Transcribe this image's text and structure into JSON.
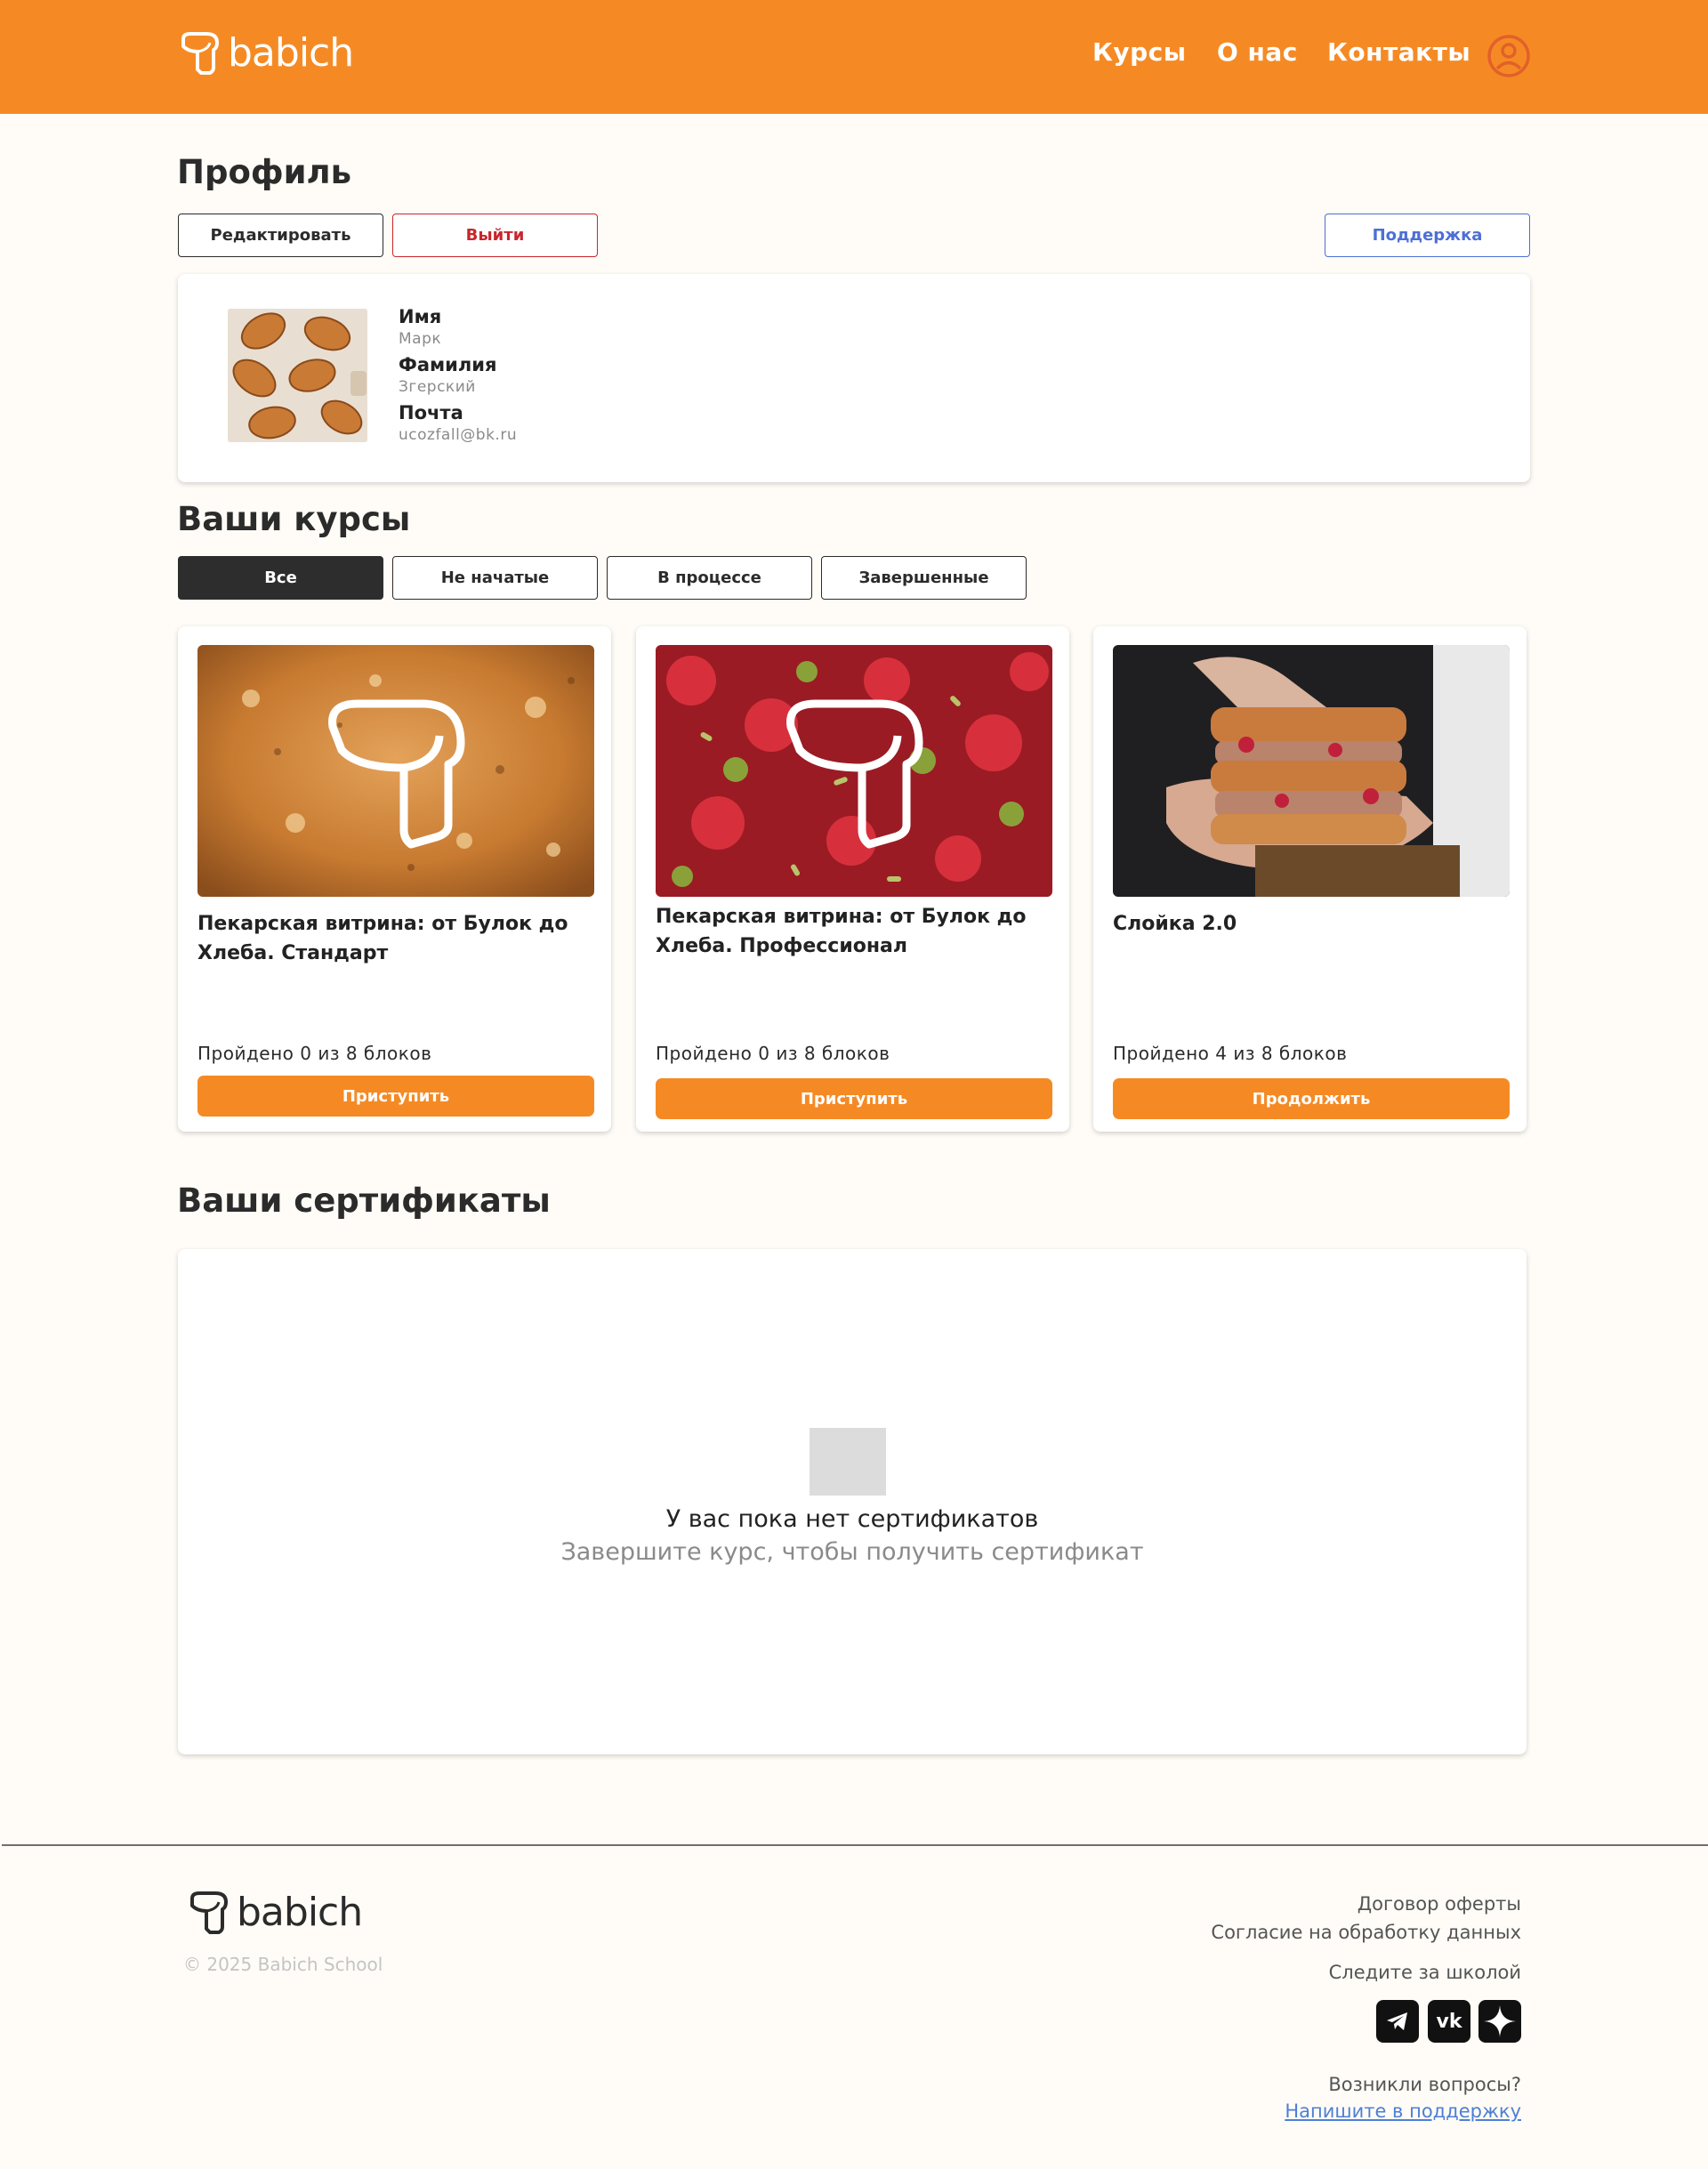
{
  "header": {
    "logo_text": "babich",
    "nav": [
      {
        "label": "Курсы"
      },
      {
        "label": "О нас"
      },
      {
        "label": "Контакты"
      }
    ],
    "user_icon": "user-circle-icon"
  },
  "profile": {
    "title": "Профиль",
    "edit_label": "Редактировать",
    "logout_label": "Выйти",
    "support_label": "Поддержка",
    "fields": {
      "name_label": "Имя",
      "name_value": "Марк",
      "surname_label": "Фамилия",
      "surname_value": "Згерский",
      "email_label": "Почта",
      "email_value": "ucozfall@bk.ru"
    }
  },
  "courses": {
    "title": "Ваши курсы",
    "filters": [
      {
        "label": "Все",
        "active": true
      },
      {
        "label": "Не начатые",
        "active": false
      },
      {
        "label": "В процессе",
        "active": false
      },
      {
        "label": "Завершенные",
        "active": false
      }
    ],
    "items": [
      {
        "title": "Пекарская витрина: от Булок до Хлеба. Стандарт",
        "progress": "Пройдено 0 из 8 блоков",
        "button": "Приступить",
        "completed_blocks": 0,
        "total_blocks": 8
      },
      {
        "title": "Пекарская витрина: от Булок до Хлеба. Профессионал",
        "progress": "Пройдено 0 из 8 блоков",
        "button": "Приступить",
        "completed_blocks": 0,
        "total_blocks": 8
      },
      {
        "title": "Слойка 2.0",
        "progress": "Пройдено 4 из 8 блоков",
        "button": "Продолжить",
        "completed_blocks": 4,
        "total_blocks": 8
      }
    ]
  },
  "certificates": {
    "title": "Ваши сертификаты",
    "empty_title": "У вас пока нет сертификатов",
    "empty_subtitle": "Завершите курс, чтобы получить сертификат"
  },
  "footer": {
    "logo_text": "babich",
    "copyright": "© 2025 Babich School",
    "offer": "Договор оферты",
    "consent": "Согласие на обработку данных",
    "follow": "Следите за школой",
    "question": "Возникли вопросы?",
    "support_link": "Напишите в поддержку",
    "socials": [
      "telegram-icon",
      "vk-icon",
      "yandex-zen-icon"
    ]
  },
  "colors": {
    "brand": "#f58a24",
    "dark": "#2d2d2d",
    "danger": "#c9262c",
    "link": "#4d6fd6",
    "background": "#fffcf7"
  }
}
